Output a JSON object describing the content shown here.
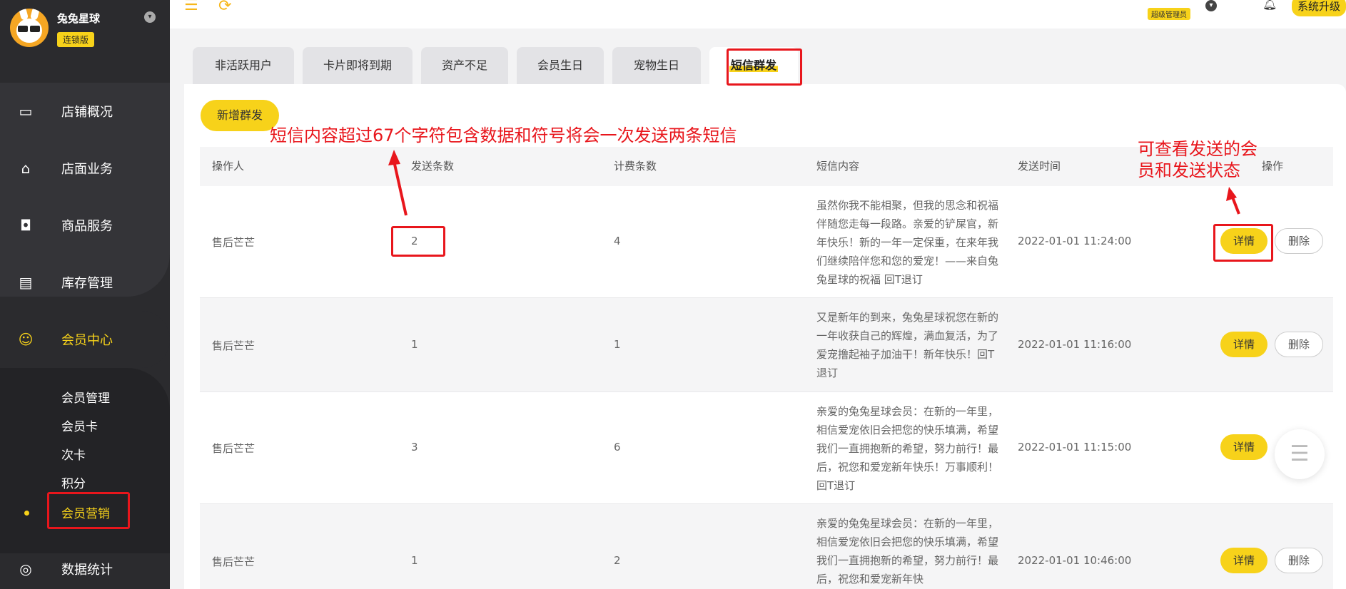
{
  "brand": {
    "name": "兔兔星球",
    "badge": "连锁版"
  },
  "nav": {
    "items": [
      {
        "label": "店铺概况",
        "icon": "chart-screen-icon"
      },
      {
        "label": "店面业务",
        "icon": "house-icon"
      },
      {
        "label": "商品服务",
        "icon": "bag-icon"
      },
      {
        "label": "库存管理",
        "icon": "box-icon"
      },
      {
        "label": "会员中心",
        "icon": "member-icon"
      },
      {
        "label": "数据统计",
        "icon": "trend-icon"
      }
    ],
    "sub_items": [
      "会员管理",
      "会员卡",
      "次卡",
      "积分",
      "会员营销"
    ]
  },
  "topbar": {
    "admin_role": "超级管理员",
    "upgrade_label": "系统升级"
  },
  "tabs": [
    "非活跃用户",
    "卡片即将到期",
    "资产不足",
    "会员生日",
    "宠物生日",
    "短信群发"
  ],
  "add_button_label": "新增群发",
  "table": {
    "headers": [
      "操作人",
      "发送条数",
      "计费条数",
      "短信内容",
      "发送时间",
      "操作"
    ],
    "rows": [
      {
        "operator": "售后芒芒",
        "sent_count": "2",
        "billed_count": "4",
        "content": "虽然你我不能相聚，但我的思念和祝福伴随您走每一段路。亲爱的铲屎官，新年快乐！新的一年一定保重，在来年我们继续陪伴您和您的爱宠！——来自兔兔星球的祝福 回T退订",
        "time": "2022-01-01 11:24:00",
        "detail_label": "详情",
        "delete_label": "删除"
      },
      {
        "operator": "售后芒芒",
        "sent_count": "1",
        "billed_count": "1",
        "content": "又是新年的到来，兔兔星球祝您在新的一年收获自己的辉煌，满血复活，为了爱宠撸起袖子加油干！新年快乐！回T退订",
        "time": "2022-01-01 11:16:00",
        "detail_label": "详情",
        "delete_label": "删除"
      },
      {
        "operator": "售后芒芒",
        "sent_count": "3",
        "billed_count": "6",
        "content": "亲爱的兔兔星球会员：在新的一年里，相信爱宠依旧会把您的快乐填满，希望我们一直拥抱新的希望，努力前行！最后，祝您和爱宠新年快乐！万事顺利！回T退订",
        "time": "2022-01-01 11:15:00",
        "detail_label": "详情",
        "delete_label": ""
      },
      {
        "operator": "售后芒芒",
        "sent_count": "1",
        "billed_count": "2",
        "content": "亲爱的兔兔星球会员：在新的一年里，相信爱宠依旧会把您的快乐填满，希望我们一直拥抱新的希望，努力前行！最后，祝您和爱宠新年快",
        "time": "2022-01-01 10:46:00",
        "detail_label": "详情",
        "delete_label": "删除"
      }
    ]
  },
  "annotations": {
    "sms_note": "短信内容超过67个字符包含数据和符号将会一次发送两条短信",
    "detail_note_line1": "可查看发送的会",
    "detail_note_line2": "员和发送状态"
  },
  "colors": {
    "accent": "#f7d21a",
    "sidebar": "#2b2b2e",
    "annotation": "#e8161c"
  }
}
